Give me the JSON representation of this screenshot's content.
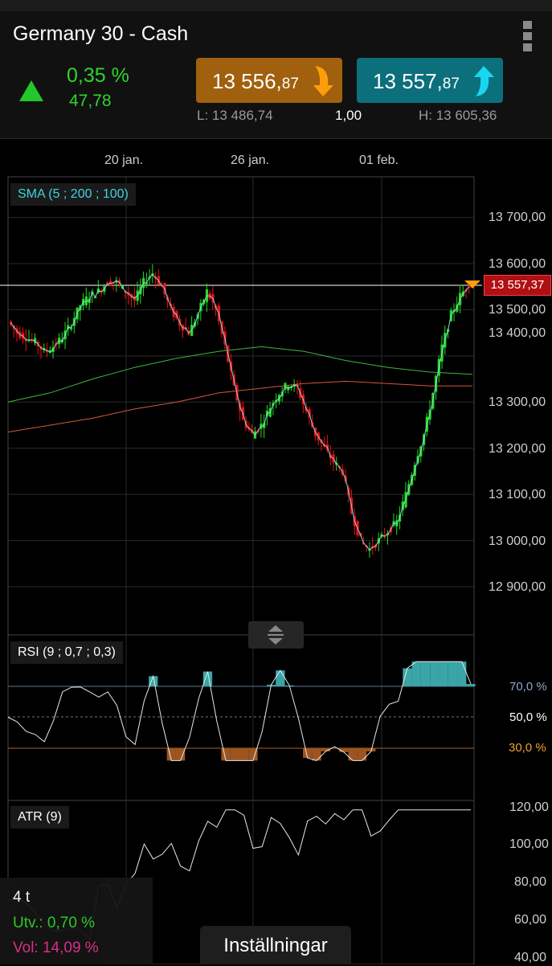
{
  "instrument": {
    "title": "Germany 30 - Cash"
  },
  "change": {
    "percent": "0,35 %",
    "points": "47,78",
    "direction": "up"
  },
  "quote": {
    "bid_main": "13 556,",
    "bid_dec": "87",
    "ask_main": "13 557,",
    "ask_dec": "87",
    "low": "L: 13 486,74",
    "spread": "1,00",
    "high": "H: 13 605,36"
  },
  "x_labels": [
    "20 jan.",
    "26 jan.",
    "01 feb."
  ],
  "main_chart": {
    "indicator": "SMA (5 ; 200 ; 100)",
    "y_labels": [
      "13 700,00",
      "13 600,00",
      "13 500,00",
      "13 400,00",
      "13 300,00",
      "13 200,00",
      "13 100,00",
      "13 000,00",
      "12 900,00"
    ],
    "current_price": "13 557,37"
  },
  "rsi": {
    "label": "RSI (9 ; 0,7 ; 0,3)",
    "levels": [
      "70,0 %",
      "50,0 %",
      "30,0 %"
    ]
  },
  "atr": {
    "label": "ATR (9)",
    "levels": [
      "120,00",
      "100,00",
      "80,00",
      "60,00",
      "40,00"
    ]
  },
  "info": {
    "timeframe": "4 t",
    "deviation": "Utv.: 0,70 %",
    "volatility": "Vol: 14,09 %"
  },
  "settings_label": "Inställningar",
  "colors": {
    "up": "#22dd22",
    "down": "#ee1111",
    "bid": "#a0600d",
    "ask": "#0c6f7c",
    "rsi_high": "#3aa5a8",
    "rsi_low": "#9c5520"
  },
  "chart_data": {
    "type": "candlestick",
    "close_path": [
      13475,
      13450,
      13440,
      13430,
      13410,
      13420,
      13440,
      13470,
      13510,
      13530,
      13540,
      13560,
      13560,
      13540,
      13520,
      13560,
      13580,
      13550,
      13500,
      13470,
      13450,
      13490,
      13540,
      13500,
      13420,
      13330,
      13260,
      13230,
      13250,
      13290,
      13320,
      13340,
      13330,
      13280,
      13230,
      13200,
      13170,
      13150,
      13060,
      13000,
      12980,
      13000,
      13020,
      13040,
      13100,
      13170,
      13230,
      13320,
      13420,
      13490,
      13530,
      13557
    ],
    "sma_long_green": [
      13300,
      13320,
      13350,
      13375,
      13395,
      13410,
      13420,
      13410,
      13390,
      13375,
      13365,
      13360
    ],
    "sma_long_red": [
      13235,
      13250,
      13265,
      13285,
      13300,
      13320,
      13330,
      13340,
      13345,
      13340,
      13335,
      13335
    ]
  }
}
